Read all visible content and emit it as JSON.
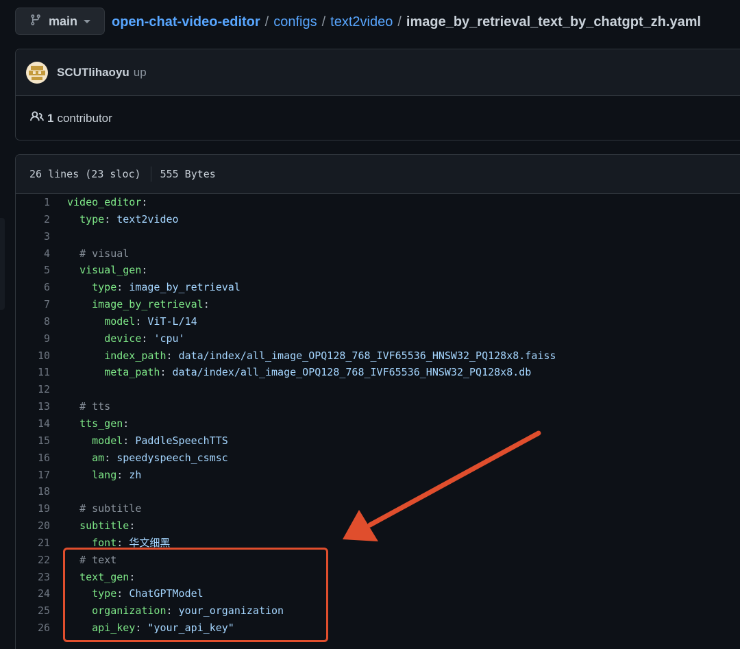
{
  "branch": {
    "icon": "git-branch-icon",
    "name": "main"
  },
  "breadcrumb": {
    "repo": "open-chat-video-editor",
    "separator": "/",
    "folder1": "configs",
    "folder2": "text2video",
    "file": "image_by_retrieval_text_by_chatgpt_zh.yaml"
  },
  "commit": {
    "author": "SCUTlihaoyu",
    "message": "up"
  },
  "contributors": {
    "icon": "people-icon",
    "count": "1",
    "label": "contributor"
  },
  "file_info": {
    "lines": "26 lines (23 sloc)",
    "size": "555 Bytes"
  },
  "code_lines": [
    {
      "n": "1",
      "indent": "",
      "key": "video_editor",
      "sep": ":",
      "val": "",
      "comment": ""
    },
    {
      "n": "2",
      "indent": "  ",
      "key": "type",
      "sep": ": ",
      "val": "text2video",
      "comment": ""
    },
    {
      "n": "3",
      "indent": "",
      "key": "",
      "sep": "",
      "val": "",
      "comment": ""
    },
    {
      "n": "4",
      "indent": "  ",
      "key": "",
      "sep": "",
      "val": "",
      "comment": "# visual"
    },
    {
      "n": "5",
      "indent": "  ",
      "key": "visual_gen",
      "sep": ":",
      "val": "",
      "comment": ""
    },
    {
      "n": "6",
      "indent": "    ",
      "key": "type",
      "sep": ": ",
      "val": "image_by_retrieval",
      "comment": ""
    },
    {
      "n": "7",
      "indent": "    ",
      "key": "image_by_retrieval",
      "sep": ":",
      "val": "",
      "comment": ""
    },
    {
      "n": "8",
      "indent": "      ",
      "key": "model",
      "sep": ": ",
      "val": "ViT-L/14",
      "comment": ""
    },
    {
      "n": "9",
      "indent": "      ",
      "key": "device",
      "sep": ": ",
      "val": "'cpu'",
      "comment": ""
    },
    {
      "n": "10",
      "indent": "      ",
      "key": "index_path",
      "sep": ": ",
      "val": "data/index/all_image_OPQ128_768_IVF65536_HNSW32_PQ128x8.faiss",
      "comment": ""
    },
    {
      "n": "11",
      "indent": "      ",
      "key": "meta_path",
      "sep": ": ",
      "val": "data/index/all_image_OPQ128_768_IVF65536_HNSW32_PQ128x8.db",
      "comment": ""
    },
    {
      "n": "12",
      "indent": "",
      "key": "",
      "sep": "",
      "val": "",
      "comment": ""
    },
    {
      "n": "13",
      "indent": "  ",
      "key": "",
      "sep": "",
      "val": "",
      "comment": "# tts"
    },
    {
      "n": "14",
      "indent": "  ",
      "key": "tts_gen",
      "sep": ":",
      "val": "",
      "comment": ""
    },
    {
      "n": "15",
      "indent": "    ",
      "key": "model",
      "sep": ": ",
      "val": "PaddleSpeechTTS",
      "comment": ""
    },
    {
      "n": "16",
      "indent": "    ",
      "key": "am",
      "sep": ": ",
      "val": "speedyspeech_csmsc",
      "comment": ""
    },
    {
      "n": "17",
      "indent": "    ",
      "key": "lang",
      "sep": ": ",
      "val": "zh",
      "comment": ""
    },
    {
      "n": "18",
      "indent": "",
      "key": "",
      "sep": "",
      "val": "",
      "comment": ""
    },
    {
      "n": "19",
      "indent": "  ",
      "key": "",
      "sep": "",
      "val": "",
      "comment": "# subtitle"
    },
    {
      "n": "20",
      "indent": "  ",
      "key": "subtitle",
      "sep": ":",
      "val": "",
      "comment": ""
    },
    {
      "n": "21",
      "indent": "    ",
      "key": "font",
      "sep": ": ",
      "val": "华文细黑",
      "comment": ""
    },
    {
      "n": "22",
      "indent": "  ",
      "key": "",
      "sep": "",
      "val": "",
      "comment": "# text"
    },
    {
      "n": "23",
      "indent": "  ",
      "key": "text_gen",
      "sep": ":",
      "val": "",
      "comment": ""
    },
    {
      "n": "24",
      "indent": "    ",
      "key": "type",
      "sep": ": ",
      "val": "ChatGPTModel",
      "comment": ""
    },
    {
      "n": "25",
      "indent": "    ",
      "key": "organization",
      "sep": ": ",
      "val": "your_organization",
      "comment": ""
    },
    {
      "n": "26",
      "indent": "    ",
      "key": "api_key",
      "sep": ": ",
      "val": "\"your_api_key\"",
      "comment": ""
    }
  ],
  "colors": {
    "background": "#0d1117",
    "link": "#58a6ff",
    "yaml_key": "#7ee787",
    "yaml_value": "#a5d6ff",
    "comment": "#8b949e",
    "annotation": "#e04e2d"
  }
}
